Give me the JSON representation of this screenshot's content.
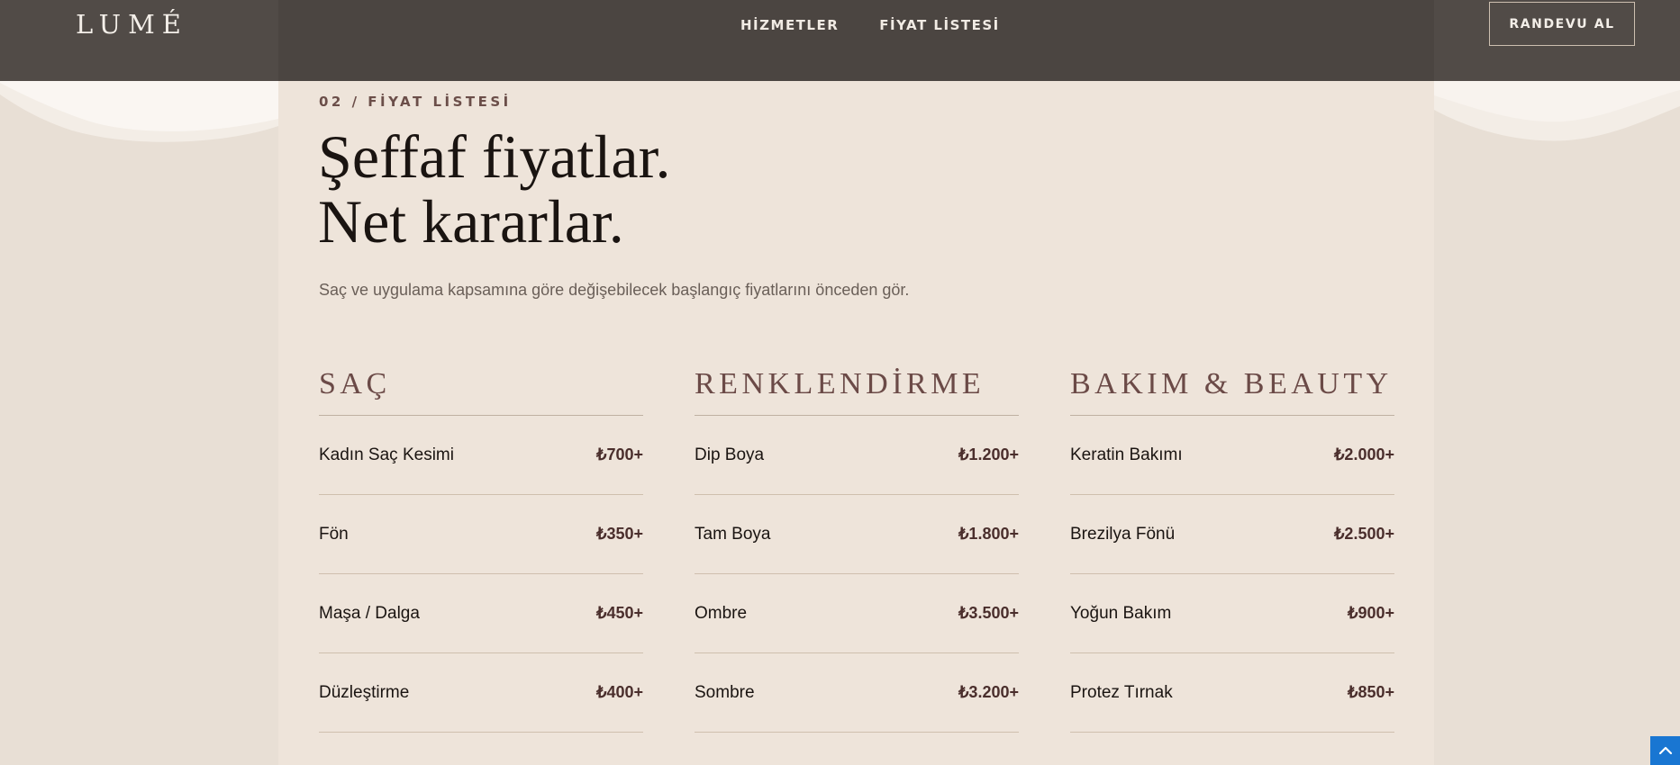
{
  "header": {
    "logo": "LUMÉ",
    "nav": [
      {
        "label": "HİZMETLER"
      },
      {
        "label": "FİYAT LİSTESİ"
      }
    ],
    "cta_label": "RANDEVU AL"
  },
  "section": {
    "eyebrow": "02 / FİYAT LİSTESİ",
    "title_line1": "Şeffaf fiyatlar.",
    "title_line2": "Net kararlar.",
    "subtitle": "Saç ve uygulama kapsamına göre değişebilecek başlangıç fiyatlarını önceden gör."
  },
  "categories": [
    {
      "title": "SAÇ",
      "items": [
        {
          "name": "Kadın Saç Kesimi",
          "price": "₺700+"
        },
        {
          "name": "Fön",
          "price": "₺350+"
        },
        {
          "name": "Maşa / Dalga",
          "price": "₺450+"
        },
        {
          "name": "Düzleştirme",
          "price": "₺400+"
        }
      ]
    },
    {
      "title": "RENKLENDİRME",
      "items": [
        {
          "name": "Dip Boya",
          "price": "₺1.200+"
        },
        {
          "name": "Tam Boya",
          "price": "₺1.800+"
        },
        {
          "name": "Ombre",
          "price": "₺3.500+"
        },
        {
          "name": "Sombre",
          "price": "₺3.200+"
        }
      ]
    },
    {
      "title": "BAKIM & BEAUTY",
      "items": [
        {
          "name": "Keratin Bakımı",
          "price": "₺2.000+"
        },
        {
          "name": "Brezilya Fönü",
          "price": "₺2.500+"
        },
        {
          "name": "Yoğun Bakım",
          "price": "₺900+"
        },
        {
          "name": "Protez Tırnak",
          "price": "₺850+"
        }
      ]
    }
  ],
  "colors": {
    "header_bg": "#4b4541",
    "page_bg": "#e8dfd5",
    "panel_bg": "#eee4da",
    "accent": "#6b4a47",
    "scroll_button": "#1976d2"
  },
  "icons": {
    "scroll_top": "chevron-up-icon"
  }
}
